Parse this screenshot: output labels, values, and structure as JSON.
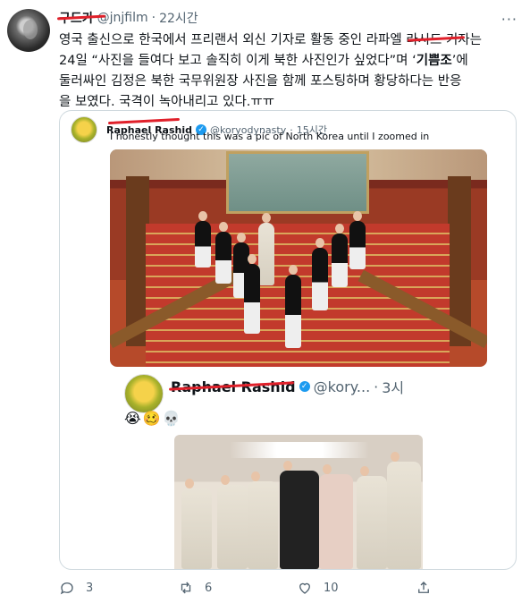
{
  "tweet": {
    "author_name": "구드가",
    "handle": "@jnjfilm",
    "separator": "·",
    "time": "22시간",
    "more_icon": "more-dots-icon",
    "text_line1": "영국 출신으로 한국에서 프리랜서 외신 기자로 활동 중인 라파엘 라시드 기자는",
    "text_line2_prefix": "24일 “사진을 들여다 보고 솔직히 이게 북한 사진인가 싶었다”며 ‘",
    "text_line2_bold": "기쁨조",
    "text_line2_suffix": "’에",
    "text_line3": "둘러싸인 김정은 북한 국무위원장 사진을 함께 포스팅하며 황당하다는 반응",
    "text_line4": "을 보였다. 국격이 녹아내리고 있다.ㅠㅠ"
  },
  "quote": {
    "author_name": "Raphael Rashid",
    "verified_icon": "verified-badge-icon",
    "handle": "@koryodynasty",
    "separator": "·",
    "time": "15시간",
    "text": "I honestly thought this was a pic of North Korea until I zoomed in"
  },
  "inner_quote": {
    "author_name": "Raphael Rashid",
    "verified_icon": "verified-badge-icon",
    "handle": "@kory...",
    "separator": "·",
    "time": "3시",
    "emojis": "😭🥴💀"
  },
  "actions": {
    "reply_count": "3",
    "retweet_count": "6",
    "like_count": "10",
    "reply_icon": "reply-icon",
    "retweet_icon": "retweet-icon",
    "like_icon": "heart-icon",
    "share_icon": "share-icon"
  },
  "colors": {
    "redaction": "#e0202a",
    "verified": "#1d9bf0",
    "secondary_text": "#536471"
  }
}
